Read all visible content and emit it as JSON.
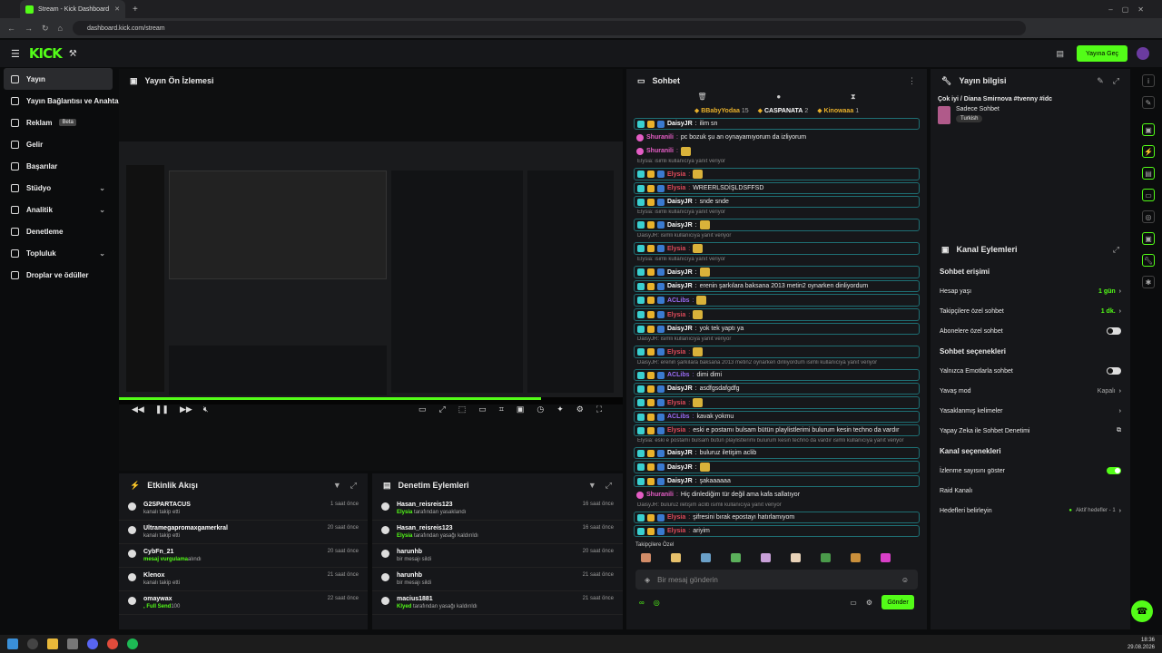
{
  "browser": {
    "tab_title": "Stream - Kick Dashboard",
    "url": "dashboard.kick.com/stream"
  },
  "appbar": {
    "logo": "KICK",
    "go_live_label": "Yayına Geç"
  },
  "sidebar": {
    "items": [
      {
        "label": "Yayın",
        "active": true
      },
      {
        "label": "Yayın Bağlantısı ve Anahtarı"
      },
      {
        "label": "Reklam",
        "badge": "Beta"
      },
      {
        "label": "Gelir"
      },
      {
        "label": "Başarılar"
      },
      {
        "label": "Stüdyo",
        "expandable": true
      },
      {
        "label": "Analitik",
        "expandable": true
      },
      {
        "label": "Denetleme"
      },
      {
        "label": "Topluluk",
        "expandable": true
      },
      {
        "label": "Droplar ve ödüller"
      }
    ]
  },
  "preview": {
    "title": "Yayın Ön İzlemesi"
  },
  "activity": {
    "title": "Etkinlik Akışı",
    "rows": [
      {
        "name": "G2SPARTACUS",
        "sub": "kanalı takip etti",
        "time": "1 saat önce"
      },
      {
        "name": "Ultramegapromaxgamerkral",
        "sub": "kanalı takip etti",
        "time": "20 saat önce"
      },
      {
        "name": "CybFn_21",
        "sub_highlight": "mesaj vurgulama",
        "sub": "alındı",
        "time": "20 saat önce"
      },
      {
        "name": "Klenox",
        "sub": "kanalı takip etti",
        "time": "21 saat önce"
      },
      {
        "name": "omaywax",
        "sub_highlight": ", Full Send",
        "sub": "100",
        "time": "22 saat önce"
      }
    ]
  },
  "moderation": {
    "title": "Denetim Eylemleri",
    "rows": [
      {
        "name": "Hasan_reisreis123",
        "by": "Elysia",
        "sub": "tarafından yasaklandı",
        "time": "16 saat önce"
      },
      {
        "name": "Hasan_reisreis123",
        "by": "Elysia",
        "sub": "tarafından yasağı kaldırıldı",
        "time": "16 saat önce"
      },
      {
        "name": "harunhb",
        "sub": "bir mesajı sildi",
        "time": "20 saat önce"
      },
      {
        "name": "harunhb",
        "sub": "bir mesajı sildi",
        "time": "21 saat önce"
      },
      {
        "name": "macius1881",
        "by": "Klyed",
        "sub": "tarafından yasağı kaldırıldı",
        "time": "21 saat önce"
      }
    ]
  },
  "chat": {
    "title": "Sohbet",
    "top_gifters": [
      {
        "name": "BBabyYodaa",
        "count": "15"
      },
      {
        "name": "CASPANATA",
        "count": "2"
      },
      {
        "name": "Kinowaaa",
        "count": "1"
      }
    ],
    "messages": [
      {
        "user": "DaisyJR",
        "text": "ilim sn",
        "color": "#ffffff"
      },
      {
        "user": "Shuranili",
        "text": "pc bozuk şu an oynayamıyorum da izliyorum",
        "color": "#e55dc5",
        "plain": true
      },
      {
        "user": "Shuranili",
        "text": "",
        "color": "#e55dc5",
        "plain": true,
        "emote": true
      },
      {
        "reply": "Elysia: isimli kullanıcıya yanıt veriyor"
      },
      {
        "user": "Elysia",
        "text": "",
        "color": "#e04b5b",
        "emote": true
      },
      {
        "user": "Elysia",
        "text": "WREERLSDİŞLDSFFSD",
        "color": "#e04b5b"
      },
      {
        "user": "DaisyJR",
        "text": "snde snde",
        "color": "#ffffff"
      },
      {
        "reply": "Elysia: isimli kullanıcıya yanıt veriyor"
      },
      {
        "user": "DaisyJR",
        "text": "",
        "color": "#ffffff",
        "emote": true
      },
      {
        "reply": "DaisyJR: isimli kullanıcıya yanıt veriyor"
      },
      {
        "user": "Elysia",
        "text": "",
        "color": "#e04b5b",
        "emote": true
      },
      {
        "reply": "Elysia: isimli kullanıcıya yanıt veriyor"
      },
      {
        "user": "DaisyJR",
        "text": "",
        "color": "#ffffff",
        "emote": true
      },
      {
        "user": "DaisyJR",
        "text": "erenin şarkılara baksana 2013 metin2 oynarken dinliyordum",
        "color": "#ffffff"
      },
      {
        "user": "ACLibs",
        "text": "",
        "color": "#9a6cf5",
        "emote": true
      },
      {
        "user": "Elysia",
        "text": "",
        "color": "#e04b5b",
        "emote": true
      },
      {
        "user": "DaisyJR",
        "text": "yok tek yaptı ya",
        "color": "#ffffff"
      },
      {
        "reply": "DaisyJR: isimli kullanıcıya yanıt veriyor"
      },
      {
        "user": "Elysia",
        "text": "",
        "color": "#e04b5b",
        "emote": true
      },
      {
        "reply": "DaisyJR: erenin şarkılara baksana 2013 metin2 oynarken dinliyordum isimli kullanıcıya yanıt veriyor"
      },
      {
        "user": "ACLibs",
        "text": "dimi dimi",
        "color": "#9a6cf5"
      },
      {
        "user": "DaisyJR",
        "text": "asdfgsdafgdfg",
        "color": "#ffffff"
      },
      {
        "user": "Elysia",
        "text": "",
        "color": "#e04b5b",
        "emote": true
      },
      {
        "user": "ACLibs",
        "text": "kavak yokmu",
        "color": "#9a6cf5"
      },
      {
        "user": "Elysia",
        "text": "eski e postamı bulsam bütün playlistlerimi bulurum kesin techno da vardır",
        "color": "#e04b5b"
      },
      {
        "reply": "Elysia: eski e postamı bulsam bütün playlistlerimi bulurum kesin techno da vardır isimli kullanıcıya yanıt veriyor"
      },
      {
        "user": "DaisyJR",
        "text": "buluruz iletişim aclib",
        "color": "#ffffff"
      },
      {
        "user": "DaisyJR",
        "text": "",
        "color": "#ffffff",
        "emote": true
      },
      {
        "user": "DaisyJR",
        "text": "şakaaaaaa",
        "color": "#ffffff"
      },
      {
        "user": "Shuranili",
        "text": "Hiç dinlediğim tür değil ama kafa sallatıyor",
        "color": "#e55dc5",
        "plain": true
      },
      {
        "reply": "DaisyJR: buluruz iletişim aclib isimli kullanıcıya yanıt veriyor"
      },
      {
        "user": "Elysia",
        "text": "şifresini bırak epostayı hatırlamıyom",
        "color": "#e04b5b"
      },
      {
        "user": "Elysia",
        "text": "ariyim",
        "color": "#e04b5b"
      }
    ],
    "followers_only_label": "Takipçilere Özel",
    "input_placeholder": "Bir mesaj gönderin",
    "send_label": "Gönder"
  },
  "stream_info": {
    "title": "Yayın bilgisi",
    "stream_title": "Çok iyi / Diana Smirnova #tvenny #idc",
    "category": "Sadece Sohbet",
    "language_tag": "Turkish"
  },
  "channel_actions": {
    "title": "Kanal Eylemleri",
    "chat_access_heading": "Sohbet erişimi",
    "chat_options_heading": "Sohbet seçenekleri",
    "channel_options_heading": "Kanal seçenekleri",
    "rows_access": [
      {
        "label": "Hesap yaşı",
        "value": "1 gün",
        "kind": "value"
      },
      {
        "label": "Takipçilere özel sohbet",
        "value": "1 dk.",
        "kind": "value"
      },
      {
        "label": "Abonelere özel sohbet",
        "kind": "toggle",
        "on": false
      }
    ],
    "rows_options": [
      {
        "label": "Yalnızca Emotlarla sohbet",
        "kind": "toggle",
        "on": false
      },
      {
        "label": "Yavaş mod",
        "value": "Kapalı",
        "kind": "grey"
      },
      {
        "label": "Yasaklanmış kelimeler",
        "kind": "arrow"
      },
      {
        "label": "Yapay Zeka ile Sohbet Denetimi",
        "kind": "ext"
      }
    ],
    "rows_channel": [
      {
        "label": "İzlenme sayısını göster",
        "kind": "toggle",
        "on": true
      },
      {
        "label": "Raid Kanalı",
        "kind": "none"
      },
      {
        "label": "Hedefleri belirleyin",
        "value": "Aktif hedefler - 1",
        "kind": "goal"
      }
    ]
  },
  "taskbar": {
    "time": "18:36",
    "date": "29.08.2026"
  },
  "colors": {
    "brand": "#53fc18",
    "panel": "#16171a",
    "background": "#0b0c0d"
  }
}
